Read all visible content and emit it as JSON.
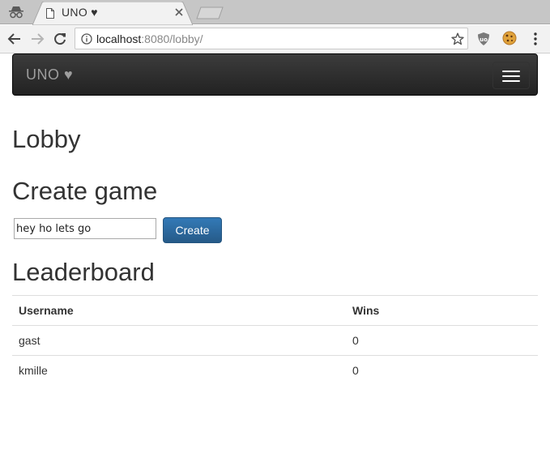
{
  "browser": {
    "tab_title": "UNO ♥",
    "url_host": "localhost",
    "url_rest": ":8080/lobby/"
  },
  "navbar": {
    "brand": "UNO ♥"
  },
  "lobby": {
    "title": "Lobby"
  },
  "create_game": {
    "title": "Create game",
    "input_value": "hey ho lets go",
    "button_label": "Create"
  },
  "leaderboard": {
    "title": "Leaderboard",
    "columns": [
      "Username",
      "Wins"
    ],
    "rows": [
      {
        "username": "gast",
        "wins": "0"
      },
      {
        "username": "kmille",
        "wins": "0"
      }
    ]
  },
  "icons": {
    "incognito": "incognito-icon",
    "page": "page-icon",
    "close": "close-icon",
    "back": "back-arrow-icon",
    "forward": "forward-arrow-icon",
    "reload": "reload-icon",
    "info": "info-icon",
    "star": "star-icon",
    "shield": "shield-extension-icon",
    "cookie": "cookie-extension-icon",
    "menu": "kebab-menu-icon",
    "hamburger": "hamburger-icon"
  },
  "colors": {
    "navbar_bg": "#222222",
    "brand_text": "#9d9d9d",
    "primary_button": "#337ab7"
  }
}
